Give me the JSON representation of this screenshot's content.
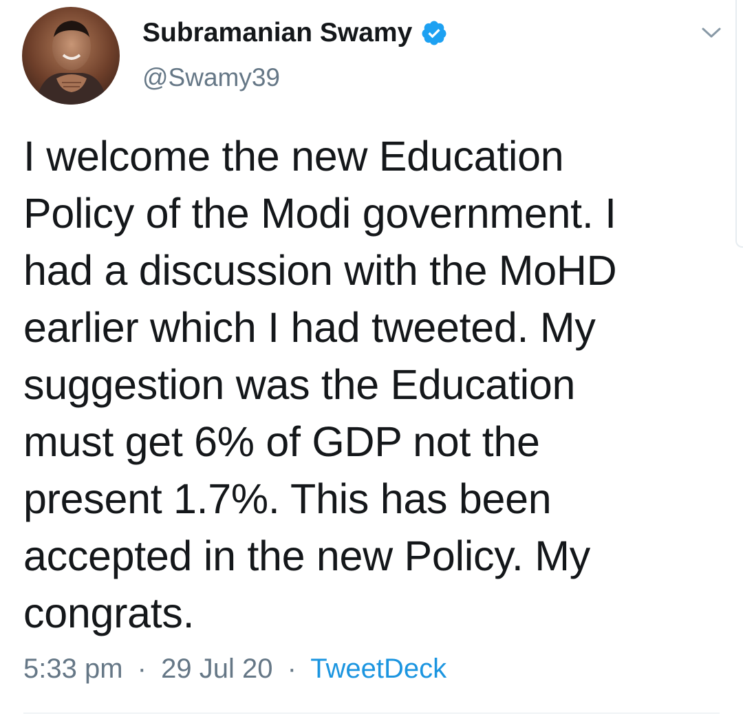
{
  "tweet": {
    "author": {
      "display_name": "Subramanian Swamy",
      "handle": "@Swamy39",
      "verified_badge_icon": "verified-badge-icon",
      "verified_color": "#1da1f2"
    },
    "menu_icon": "chevron-down-icon",
    "text": "I welcome the new Education\nPolicy of the Modi government. I\nhad a discussion with the MoHD\nearlier which I had tweeted. My\nsuggestion was the Education\nmust get 6% of GDP not the\npresent 1.7%. This has been\naccepted in the new Policy. My\ncongrats.",
    "meta": {
      "time": "5:33 pm",
      "separator": "·",
      "date": "29 Jul 20",
      "source": "TweetDeck"
    }
  },
  "colors": {
    "text_primary": "#14171a",
    "text_secondary": "#657786",
    "link": "#1b95e0",
    "divider": "#e1e8ed"
  }
}
